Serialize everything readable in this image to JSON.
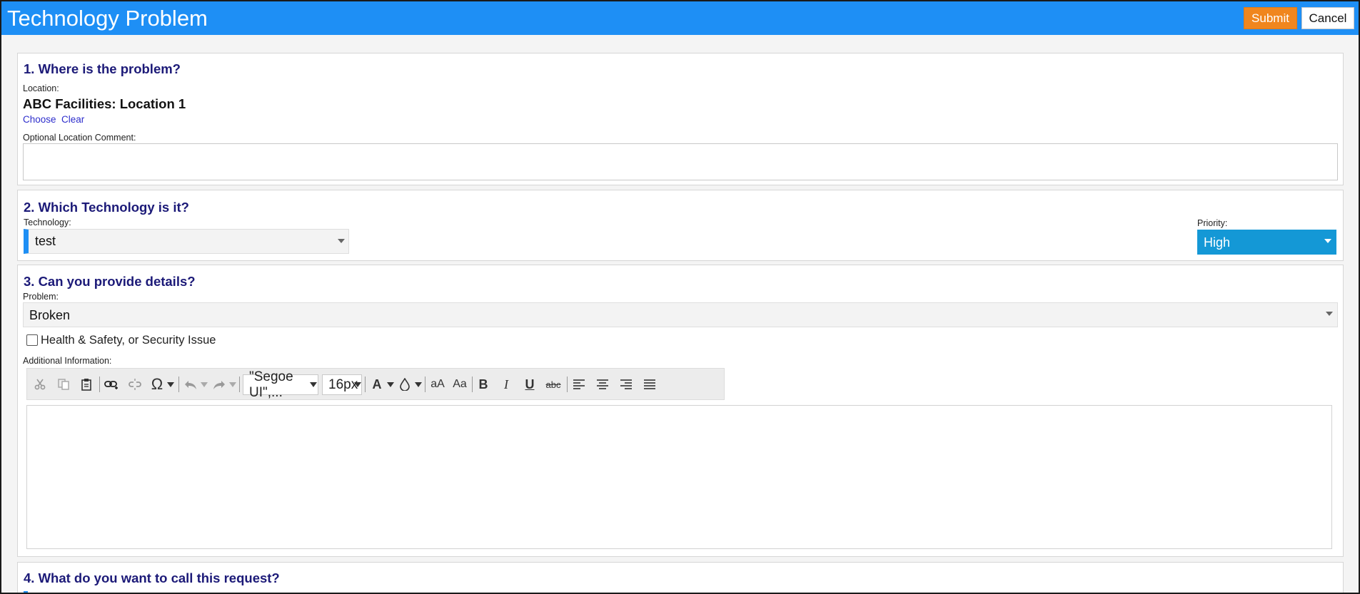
{
  "header": {
    "title": "Technology Problem",
    "submit_label": "Submit",
    "cancel_label": "Cancel"
  },
  "section1": {
    "heading": "1. Where is the problem?",
    "location_label": "Location:",
    "location_value": "ABC Facilities: Location 1",
    "choose_link": "Choose",
    "clear_link": "Clear",
    "comment_label": "Optional Location Comment:",
    "comment_value": ""
  },
  "section2": {
    "heading": "2. Which Technology is it?",
    "technology_label": "Technology:",
    "technology_value": "test",
    "priority_label": "Priority:",
    "priority_value": "High"
  },
  "section3": {
    "heading": "3. Can you provide details?",
    "problem_label": "Problem:",
    "problem_value": "Broken",
    "checkbox_label": "Health & Safety, or Security Issue",
    "checkbox_checked": false,
    "additional_label": "Additional Information:",
    "toolbar": {
      "font_family": "\"Segoe UI\",...",
      "font_size": "16px",
      "icons": [
        "cut-icon",
        "copy-icon",
        "paste-icon",
        "insert-link-icon",
        "unlink-icon",
        "special-character-icon",
        "undo-icon",
        "redo-icon",
        "font-color-icon",
        "background-color-icon",
        "uppercase-icon",
        "sentence-case-icon",
        "bold-icon",
        "italic-icon",
        "underline-icon",
        "strikethrough-icon",
        "align-left-icon",
        "align-center-icon",
        "align-right-icon",
        "justify-icon"
      ]
    }
  },
  "section4": {
    "heading": "4. What do you want to call this request?"
  },
  "colors": {
    "header_blue": "#1e8ff5",
    "submit_orange": "#f0861e",
    "heading_navy": "#1c1a78",
    "priority_blue": "#1498d6",
    "link_blue": "#2d2dcc"
  }
}
